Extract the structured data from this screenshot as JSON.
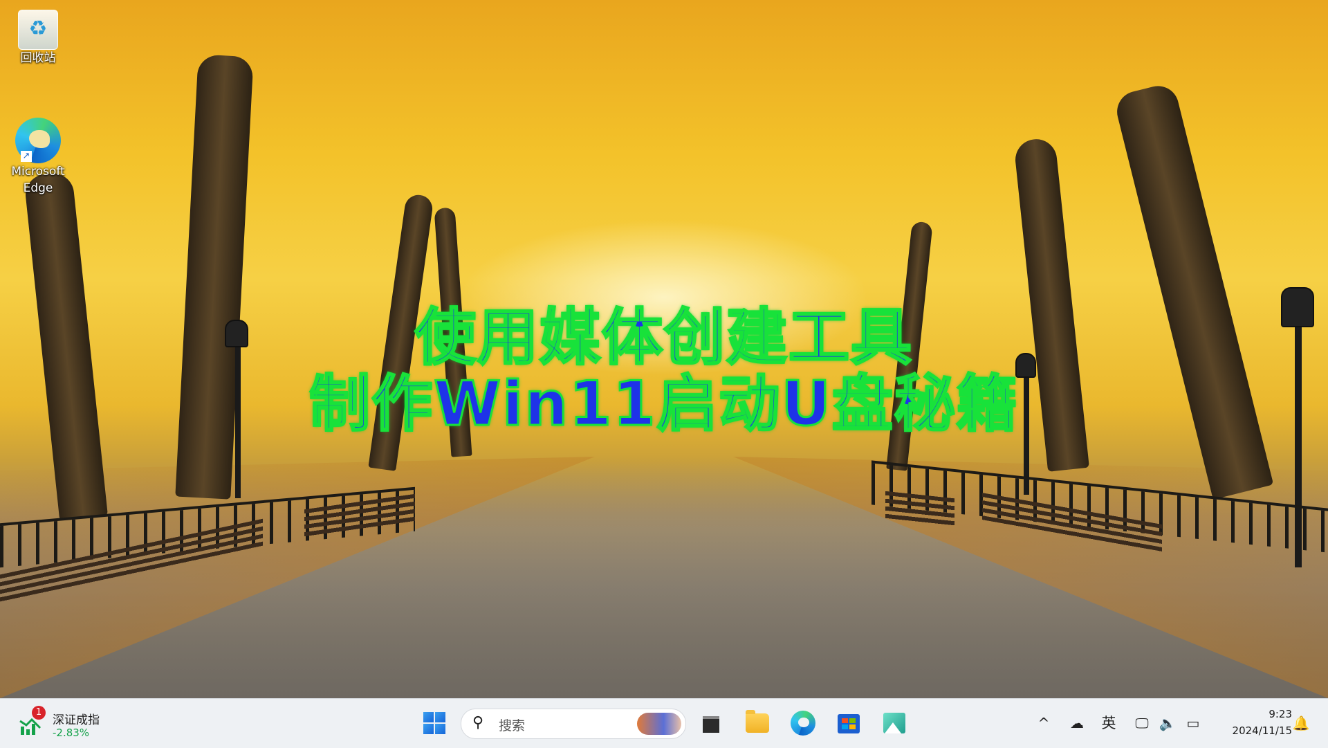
{
  "desktop": {
    "icons": [
      {
        "label": "回收站",
        "icon": "recycle-bin-icon"
      },
      {
        "label": "Microsoft Edge",
        "icon": "edge-icon"
      }
    ],
    "overlay_title": {
      "line1": "使用媒体创建工具",
      "line2": "制作Win11启动U盘秘籍",
      "fill_color": "#1e33e8",
      "stroke_color": "#18e23a"
    }
  },
  "taskbar": {
    "stock_widget": {
      "name": "深证成指",
      "change": "-2.83%",
      "badge": "1"
    },
    "search": {
      "placeholder": "搜索"
    },
    "apps": [
      "start-icon",
      "task-view-icon",
      "file-explorer-icon",
      "edge-icon",
      "store-icon",
      "photos-icon"
    ],
    "tray": {
      "chevron": "^",
      "ime": "英",
      "time": "9:23",
      "date": "2024/11/15"
    }
  }
}
